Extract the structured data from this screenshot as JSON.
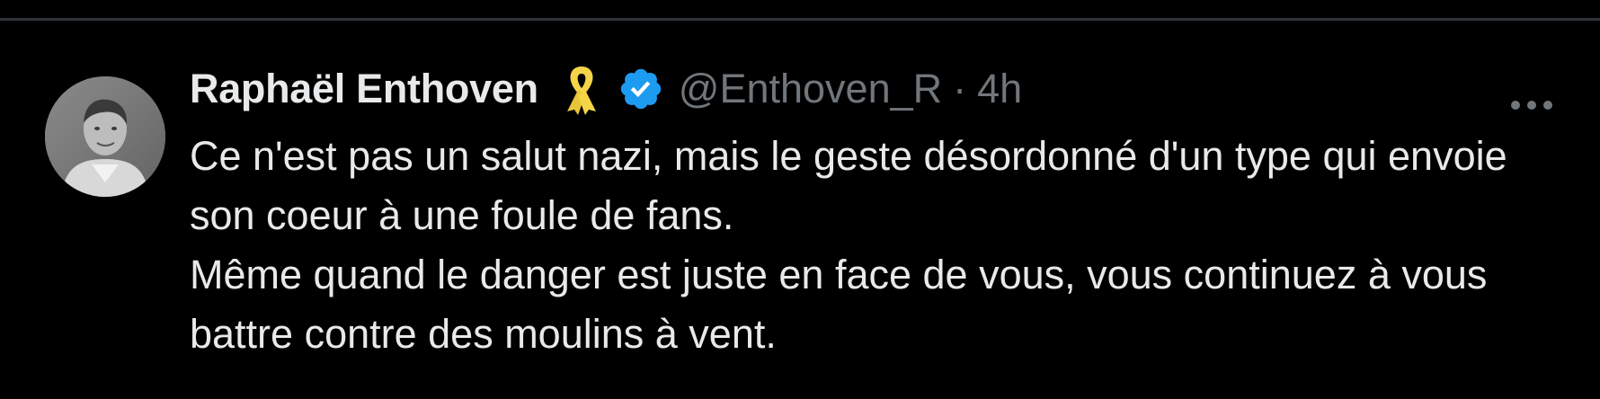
{
  "tweet": {
    "author": {
      "display_name": "Raphaël Enthoven",
      "handle": "@Enthoven_R",
      "avatar_icon": "avatar-photo",
      "badges": [
        "yellow-ribbon-icon",
        "verified-badge-icon"
      ]
    },
    "separator": "·",
    "time": "4h",
    "more_icon": "ellipsis-icon",
    "text": "Ce n'est pas un salut nazi, mais le geste désordonné d'un type qui envoie son coeur à une foule de fans.\nMême quand le danger est juste en face de vous, vous continuez à vous battre contre des moulins à vent."
  },
  "colors": {
    "background": "#000000",
    "text_primary": "#e7e9ea",
    "text_secondary": "#71767b",
    "verified": "#1d9bf0",
    "ribbon": "#f5d547",
    "divider": "#2f3336"
  }
}
